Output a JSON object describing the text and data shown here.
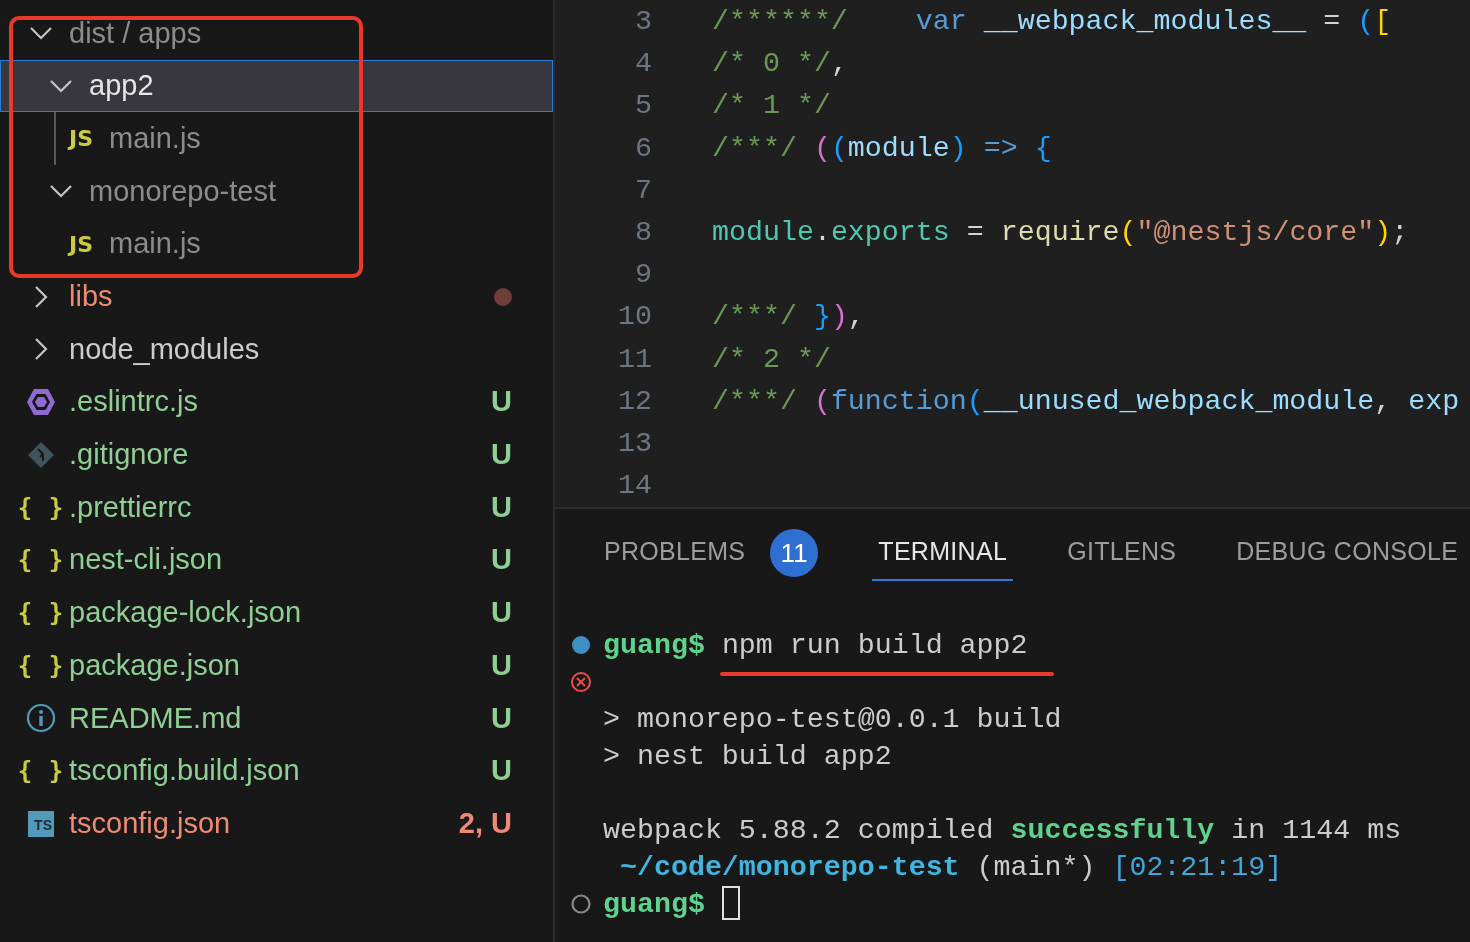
{
  "explorer": {
    "tree": [
      {
        "label": "dist / apps",
        "kind": "folder",
        "expanded": true,
        "selected": false,
        "color": "#8c8c8c",
        "framed": true,
        "children": [
          {
            "label": "app2",
            "kind": "folder",
            "expanded": true,
            "selected": true,
            "color": "#e6e6e6",
            "children": [
              {
                "label": "main.js",
                "kind": "js",
                "icon_text": "JS",
                "selected": false,
                "color": "#8c8c8c"
              }
            ]
          },
          {
            "label": "monorepo-test",
            "kind": "folder",
            "expanded": true,
            "selected": false,
            "color": "#8c8c8c",
            "children": [
              {
                "label": "main.js",
                "kind": "js",
                "icon_text": "JS",
                "selected": false,
                "color": "#8c8c8c"
              }
            ]
          }
        ]
      },
      {
        "label": "libs",
        "kind": "folder",
        "expanded": false,
        "selected": false,
        "color": "#f08a73",
        "dot": true
      },
      {
        "label": "node_modules",
        "kind": "folder",
        "expanded": false,
        "selected": false,
        "color": "#cccccc"
      },
      {
        "label": ".eslintrc.js",
        "kind": "eslint",
        "selected": false,
        "color": "#8fcf95",
        "status": "U"
      },
      {
        "label": ".gitignore",
        "kind": "git",
        "selected": false,
        "color": "#8fcf95",
        "status": "U"
      },
      {
        "label": ".prettierrc",
        "kind": "json",
        "icon_text": "{ }",
        "selected": false,
        "color": "#8fcf95",
        "status": "U"
      },
      {
        "label": "nest-cli.json",
        "kind": "json",
        "icon_text": "{ }",
        "selected": false,
        "color": "#8fcf95",
        "status": "U"
      },
      {
        "label": "package-lock.json",
        "kind": "json",
        "icon_text": "{ }",
        "selected": false,
        "color": "#8fcf95",
        "status": "U"
      },
      {
        "label": "package.json",
        "kind": "json",
        "icon_text": "{ }",
        "selected": false,
        "color": "#8fcf95",
        "status": "U"
      },
      {
        "label": "README.md",
        "kind": "info",
        "selected": false,
        "color": "#8fcf95",
        "status": "U"
      },
      {
        "label": "tsconfig.build.json",
        "kind": "json",
        "icon_text": "{ }",
        "selected": false,
        "color": "#8fcf95",
        "status": "U"
      },
      {
        "label": "tsconfig.json",
        "kind": "ts",
        "icon_text": "TS",
        "selected": false,
        "color": "#f08a73",
        "status": "2, U"
      }
    ]
  },
  "editor": {
    "lines": [
      {
        "number": "3",
        "tokens": [
          {
            "text": "/******/",
            "kind": "comment"
          },
          {
            "text": "    var",
            "kind": "keyword"
          },
          {
            "text": " __webpack_modules__",
            "kind": "variable"
          },
          {
            "text": " = ",
            "kind": "plain"
          },
          {
            "text": "(",
            "kind": "bracket2"
          },
          {
            "text": "[",
            "kind": "bracket1"
          }
        ]
      },
      {
        "number": "4",
        "tokens": [
          {
            "text": "/* 0 */",
            "kind": "comment"
          },
          {
            "text": ",",
            "kind": "plain"
          }
        ]
      },
      {
        "number": "5",
        "tokens": [
          {
            "text": "/* 1 */",
            "kind": "comment"
          }
        ]
      },
      {
        "number": "6",
        "tokens": [
          {
            "text": "/***/",
            "kind": "comment"
          },
          {
            "text": " (",
            "kind": "bracket3"
          },
          {
            "text": "(",
            "kind": "bracket2"
          },
          {
            "text": "module",
            "kind": "variable"
          },
          {
            "text": ")",
            "kind": "bracket2"
          },
          {
            "text": " =>",
            "kind": "keyword"
          },
          {
            "text": " {",
            "kind": "bracket2"
          }
        ]
      },
      {
        "number": "7"
      },
      {
        "number": "8",
        "tokens": [
          {
            "text": "module",
            "kind": "type"
          },
          {
            "text": ".",
            "kind": "plain"
          },
          {
            "text": "exports",
            "kind": "type"
          },
          {
            "text": " = ",
            "kind": "plain"
          },
          {
            "text": "require",
            "kind": "function"
          },
          {
            "text": "(",
            "kind": "bracket1"
          },
          {
            "text": "\"@nestjs/core\"",
            "kind": "string"
          },
          {
            "text": ")",
            "kind": "bracket1"
          },
          {
            "text": ";",
            "kind": "plain"
          }
        ]
      },
      {
        "number": "9"
      },
      {
        "number": "10",
        "tokens": [
          {
            "text": "/***/",
            "kind": "comment"
          },
          {
            "text": " }",
            "kind": "bracket2"
          },
          {
            "text": ")",
            "kind": "bracket3"
          },
          {
            "text": ",",
            "kind": "plain"
          }
        ]
      },
      {
        "number": "11",
        "tokens": [
          {
            "text": "/* 2 */",
            "kind": "comment"
          }
        ]
      },
      {
        "number": "12",
        "tokens": [
          {
            "text": "/***/",
            "kind": "comment"
          },
          {
            "text": " (",
            "kind": "bracket3"
          },
          {
            "text": "function",
            "kind": "keyword"
          },
          {
            "text": "(",
            "kind": "bracket2"
          },
          {
            "text": "__unused_webpack_module",
            "kind": "variable"
          },
          {
            "text": ", ",
            "kind": "plain"
          },
          {
            "text": "exp",
            "kind": "variable"
          }
        ]
      },
      {
        "number": "13"
      },
      {
        "number": "14"
      }
    ]
  },
  "panel": {
    "tabs": [
      {
        "label": "PROBLEMS",
        "selected": false,
        "count": "11"
      },
      {
        "label": "TERMINAL",
        "selected": true
      },
      {
        "label": "GITLENS",
        "selected": false
      },
      {
        "label": "DEBUG CONSOLE",
        "selected": false
      }
    ],
    "terminal": {
      "lines": [
        {
          "kind": "command",
          "segments": [
            {
              "text": "guang$ ",
              "kind": "prompt"
            },
            {
              "text": "npm run build app2",
              "kind": "plain",
              "underlined": true
            }
          ]
        },
        {
          "kind": "error"
        },
        {
          "kind": "output",
          "segments": [
            {
              "text": "> monorepo-test@0.0.1 build",
              "kind": "plain"
            }
          ]
        },
        {
          "kind": "output",
          "segments": [
            {
              "text": "> nest build app2",
              "kind": "plain"
            }
          ]
        },
        {
          "kind": "output"
        },
        {
          "kind": "output",
          "segments": [
            {
              "text": "webpack 5.88.2 compiled ",
              "kind": "plain"
            },
            {
              "text": "successfully",
              "kind": "prompt"
            },
            {
              "text": " in 1144 ms",
              "kind": "plain"
            }
          ]
        },
        {
          "kind": "output",
          "segments": [
            {
              "text": " ~/code/monorepo-test",
              "kind": "path"
            },
            {
              "text": " (main*) ",
              "kind": "plain"
            },
            {
              "text": "[02:21:19]",
              "kind": "time"
            }
          ]
        },
        {
          "kind": "pending",
          "cursor": true,
          "segments": [
            {
              "text": "guang$ ",
              "kind": "prompt"
            }
          ]
        }
      ]
    }
  }
}
